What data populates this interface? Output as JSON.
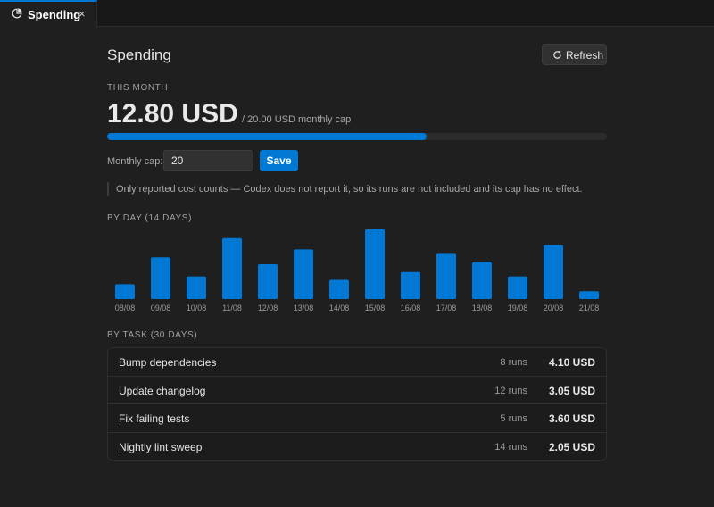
{
  "tab": {
    "label": "Spending",
    "close": "×"
  },
  "header": {
    "title": "Spending",
    "refresh_label": "Refresh"
  },
  "month": {
    "section_label": "THIS MONTH",
    "amount": "12.80 USD",
    "cap_text": "/ 20.00 USD monthly cap",
    "progress_fraction": 0.64
  },
  "cap_form": {
    "label": "Monthly cap:",
    "value": "20",
    "save_label": "Save"
  },
  "note": "Only reported cost counts — Codex does not report it, so its runs are not included and its cap has no effect.",
  "by_day": {
    "section_label": "BY DAY (14 DAYS)"
  },
  "chart_data": {
    "type": "bar",
    "categories": [
      "08/08",
      "09/08",
      "10/08",
      "11/08",
      "12/08",
      "13/08",
      "14/08",
      "15/08",
      "16/08",
      "17/08",
      "18/08",
      "19/08",
      "20/08",
      "21/08"
    ],
    "values": [
      0.85,
      2.4,
      1.3,
      3.5,
      2.0,
      2.85,
      1.1,
      4.0,
      1.55,
      2.65,
      2.15,
      1.3,
      3.1,
      0.45
    ],
    "ylim": [
      0,
      4.0
    ],
    "grid": false,
    "color": "#0078d4"
  },
  "by_task": {
    "section_label": "BY TASK (30 DAYS)",
    "rows": [
      {
        "name": "Bump dependencies",
        "runs": "8 runs",
        "cost": "4.10 USD"
      },
      {
        "name": "Update changelog",
        "runs": "12 runs",
        "cost": "3.05 USD"
      },
      {
        "name": "Fix failing tests",
        "runs": "5 runs",
        "cost": "3.60 USD"
      },
      {
        "name": "Nightly lint sweep",
        "runs": "14 runs",
        "cost": "2.05 USD"
      }
    ]
  }
}
